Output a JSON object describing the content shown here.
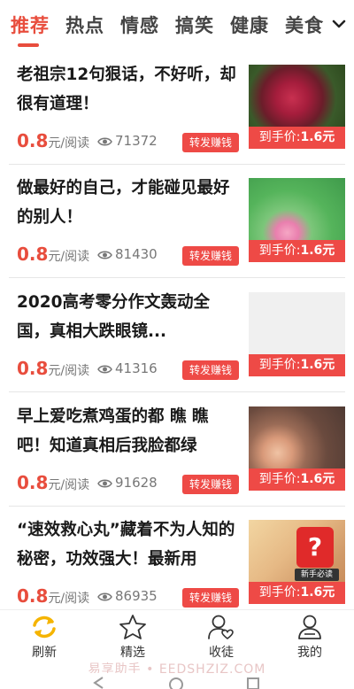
{
  "tabs": [
    {
      "label": "推荐",
      "active": true
    },
    {
      "label": "热点",
      "active": false
    },
    {
      "label": "情感",
      "active": false
    },
    {
      "label": "搞笑",
      "active": false
    },
    {
      "label": "健康",
      "active": false
    },
    {
      "label": "美食",
      "active": false
    }
  ],
  "articles": [
    {
      "title": "老祖宗12句狠话，不好听，却很有道理！",
      "price": "0.8",
      "price_unit": "元/阅读",
      "views": "71372",
      "share_label": "转发赚钱",
      "thumb_label": "到手价:",
      "thumb_price": "1.6元",
      "thumb_icon": "rose-image"
    },
    {
      "title": "做最好的自己，才能碰见最好的别人！",
      "price": "0.8",
      "price_unit": "元/阅读",
      "views": "81430",
      "share_label": "转发赚钱",
      "thumb_label": "到手价:",
      "thumb_price": "1.6元",
      "thumb_icon": "lotus-image"
    },
    {
      "title": "2020高考零分作文轰动全国，真相大跌眼镜...",
      "price": "0.8",
      "price_unit": "元/阅读",
      "views": "41316",
      "share_label": "转发赚钱",
      "thumb_label": "到手价:",
      "thumb_price": "1.6元",
      "thumb_icon": "blank-image"
    },
    {
      "title": "早上爱吃煮鸡蛋的都 瞧 瞧吧！知道真相后我脸都绿",
      "price": "0.8",
      "price_unit": "元/阅读",
      "views": "91628",
      "share_label": "转发赚钱",
      "thumb_label": "到手价:",
      "thumb_price": "1.6元",
      "thumb_icon": "eggs-image"
    },
    {
      "title": "“速效救心丸”藏着不为人知的秘密，功效强大！最新用",
      "price": "0.8",
      "price_unit": "元/阅读",
      "views": "86935",
      "share_label": "转发赚钱",
      "thumb_label": "到手价:",
      "thumb_price": "1.6元",
      "thumb_icon": "gift-badge-image",
      "badge_label": "新手必读"
    }
  ],
  "bottom_nav": [
    {
      "label": "刷新",
      "icon": "refresh-icon",
      "active": true
    },
    {
      "label": "精选",
      "icon": "star-icon",
      "active": false
    },
    {
      "label": "收徒",
      "icon": "user-heart-icon",
      "active": false
    },
    {
      "label": "我的",
      "icon": "profile-icon",
      "active": false
    }
  ],
  "watermark": "易享助手 • EEDSHZIZ.COM",
  "colors": {
    "accent": "#e84d3d",
    "button": "#ee4a46",
    "refresh": "#f5b400"
  }
}
